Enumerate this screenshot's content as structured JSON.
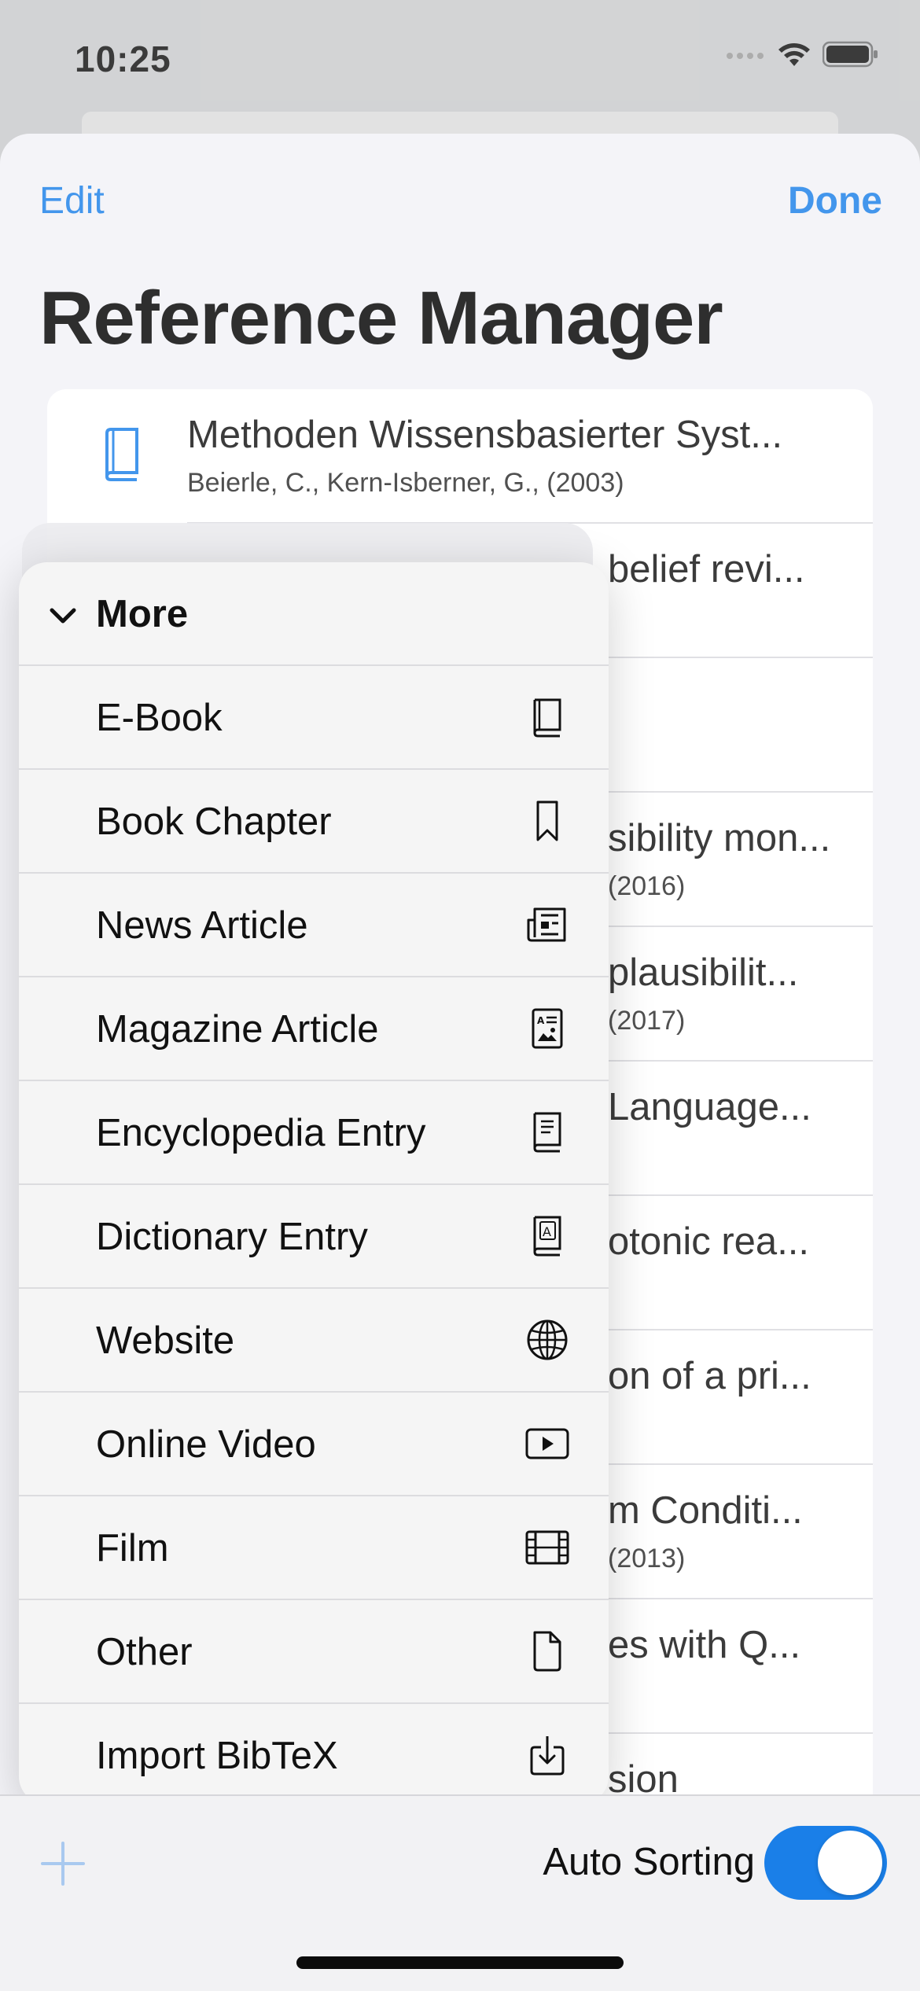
{
  "status_bar": {
    "time": "10:25"
  },
  "nav": {
    "edit_label": "Edit",
    "done_label": "Done",
    "title": "Reference Manager"
  },
  "references": [
    {
      "title": "Methoden Wissensbasierter Syst...",
      "subtitle": "Beierle, C., Kern-Isberner, G., (2003)",
      "icon": "book-icon"
    },
    {
      "title": "belief revi...",
      "subtitle": ""
    },
    {
      "title": "",
      "subtitle": ""
    },
    {
      "title": "sibility mon...",
      "subtitle": "(2016)"
    },
    {
      "title": "plausibilit...",
      "subtitle": "(2017)"
    },
    {
      "title": "Language...",
      "subtitle": ""
    },
    {
      "title": "otonic rea...",
      "subtitle": ""
    },
    {
      "title": "on of a pri...",
      "subtitle": ""
    },
    {
      "title": "m Conditi...",
      "subtitle": "(2013)"
    },
    {
      "title": "es with Q...",
      "subtitle": ""
    },
    {
      "title": "sion",
      "subtitle": ""
    }
  ],
  "menu": {
    "header_label": "More",
    "items": [
      {
        "label": "E-Book",
        "icon": "ebook-icon"
      },
      {
        "label": "Book Chapter",
        "icon": "bookmark-icon"
      },
      {
        "label": "News Article",
        "icon": "newspaper-icon"
      },
      {
        "label": "Magazine Article",
        "icon": "magazine-icon"
      },
      {
        "label": "Encyclopedia Entry",
        "icon": "encyclopedia-icon"
      },
      {
        "label": "Dictionary Entry",
        "icon": "dictionary-icon"
      },
      {
        "label": "Website",
        "icon": "globe-icon"
      },
      {
        "label": "Online Video",
        "icon": "play-icon"
      },
      {
        "label": "Film",
        "icon": "film-icon"
      },
      {
        "label": "Other",
        "icon": "document-icon"
      },
      {
        "label": "Import BibTeX",
        "icon": "import-icon"
      }
    ]
  },
  "toolbar": {
    "auto_sorting_label": "Auto Sorting",
    "auto_sorting_on": true
  },
  "colors": {
    "accent": "#1a7fe8",
    "sheet": "#f2f2f7",
    "menu": "#f5f5f5"
  }
}
